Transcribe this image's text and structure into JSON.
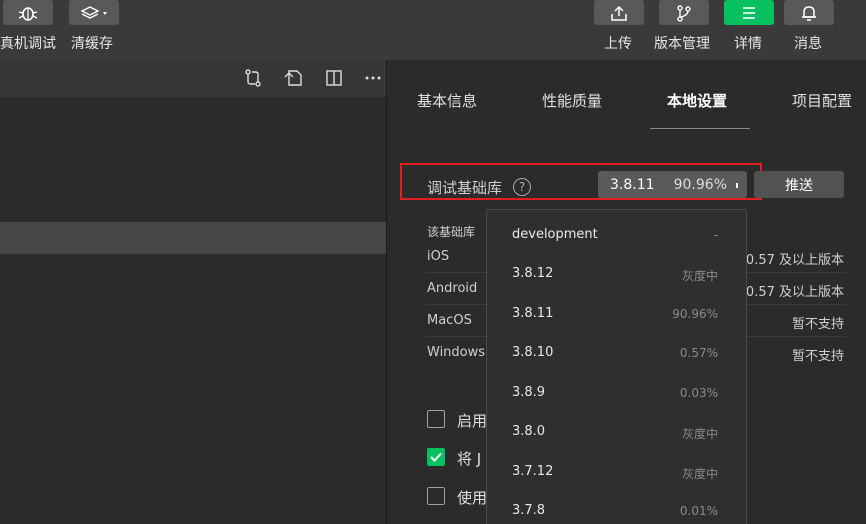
{
  "toolbar": {
    "left": [
      {
        "label": "真机调试",
        "icon": "bug-icon"
      },
      {
        "label": "清缓存",
        "icon": "layers-icon"
      }
    ],
    "right": [
      {
        "label": "上传",
        "icon": "upload-icon"
      },
      {
        "label": "版本管理",
        "icon": "branch-icon"
      },
      {
        "label": "详情",
        "icon": "menu-icon"
      },
      {
        "label": "消息",
        "icon": "bell-icon"
      }
    ],
    "accent": "#07c160"
  },
  "tabs": [
    {
      "label": "基本信息"
    },
    {
      "label": "性能质量"
    },
    {
      "label": "本地设置"
    },
    {
      "label": "项目配置"
    }
  ],
  "setting": {
    "label": "调试基础库",
    "help": "?",
    "selected_version": "3.8.11",
    "selected_percent": "90.96%",
    "push_label": "推送",
    "highlight_color": "#e02020"
  },
  "info": {
    "title": "该基础库",
    "rows": [
      {
        "label": "iOS",
        "value": "0.57 及以上版本"
      },
      {
        "label": "Android",
        "value": "0.57 及以上版本"
      },
      {
        "label": "MacOS",
        "value": "暂不支持"
      },
      {
        "label": "Windows",
        "value": "暂不支持"
      }
    ]
  },
  "checkboxes": [
    {
      "label": "启用",
      "checked": false
    },
    {
      "label": "将 J",
      "checked": true
    },
    {
      "label": "使用",
      "checked": false
    }
  ],
  "dropdown": {
    "items": [
      {
        "name": "development",
        "status": "-"
      },
      {
        "name": "3.8.12",
        "status": "灰度中"
      },
      {
        "name": "3.8.11",
        "status": "90.96%"
      },
      {
        "name": "3.8.10",
        "status": "0.57%"
      },
      {
        "name": "3.8.9",
        "status": "0.03%"
      },
      {
        "name": "3.8.0",
        "status": "灰度中"
      },
      {
        "name": "3.7.12",
        "status": "灰度中"
      },
      {
        "name": "3.7.8",
        "status": "0.01%"
      }
    ]
  }
}
